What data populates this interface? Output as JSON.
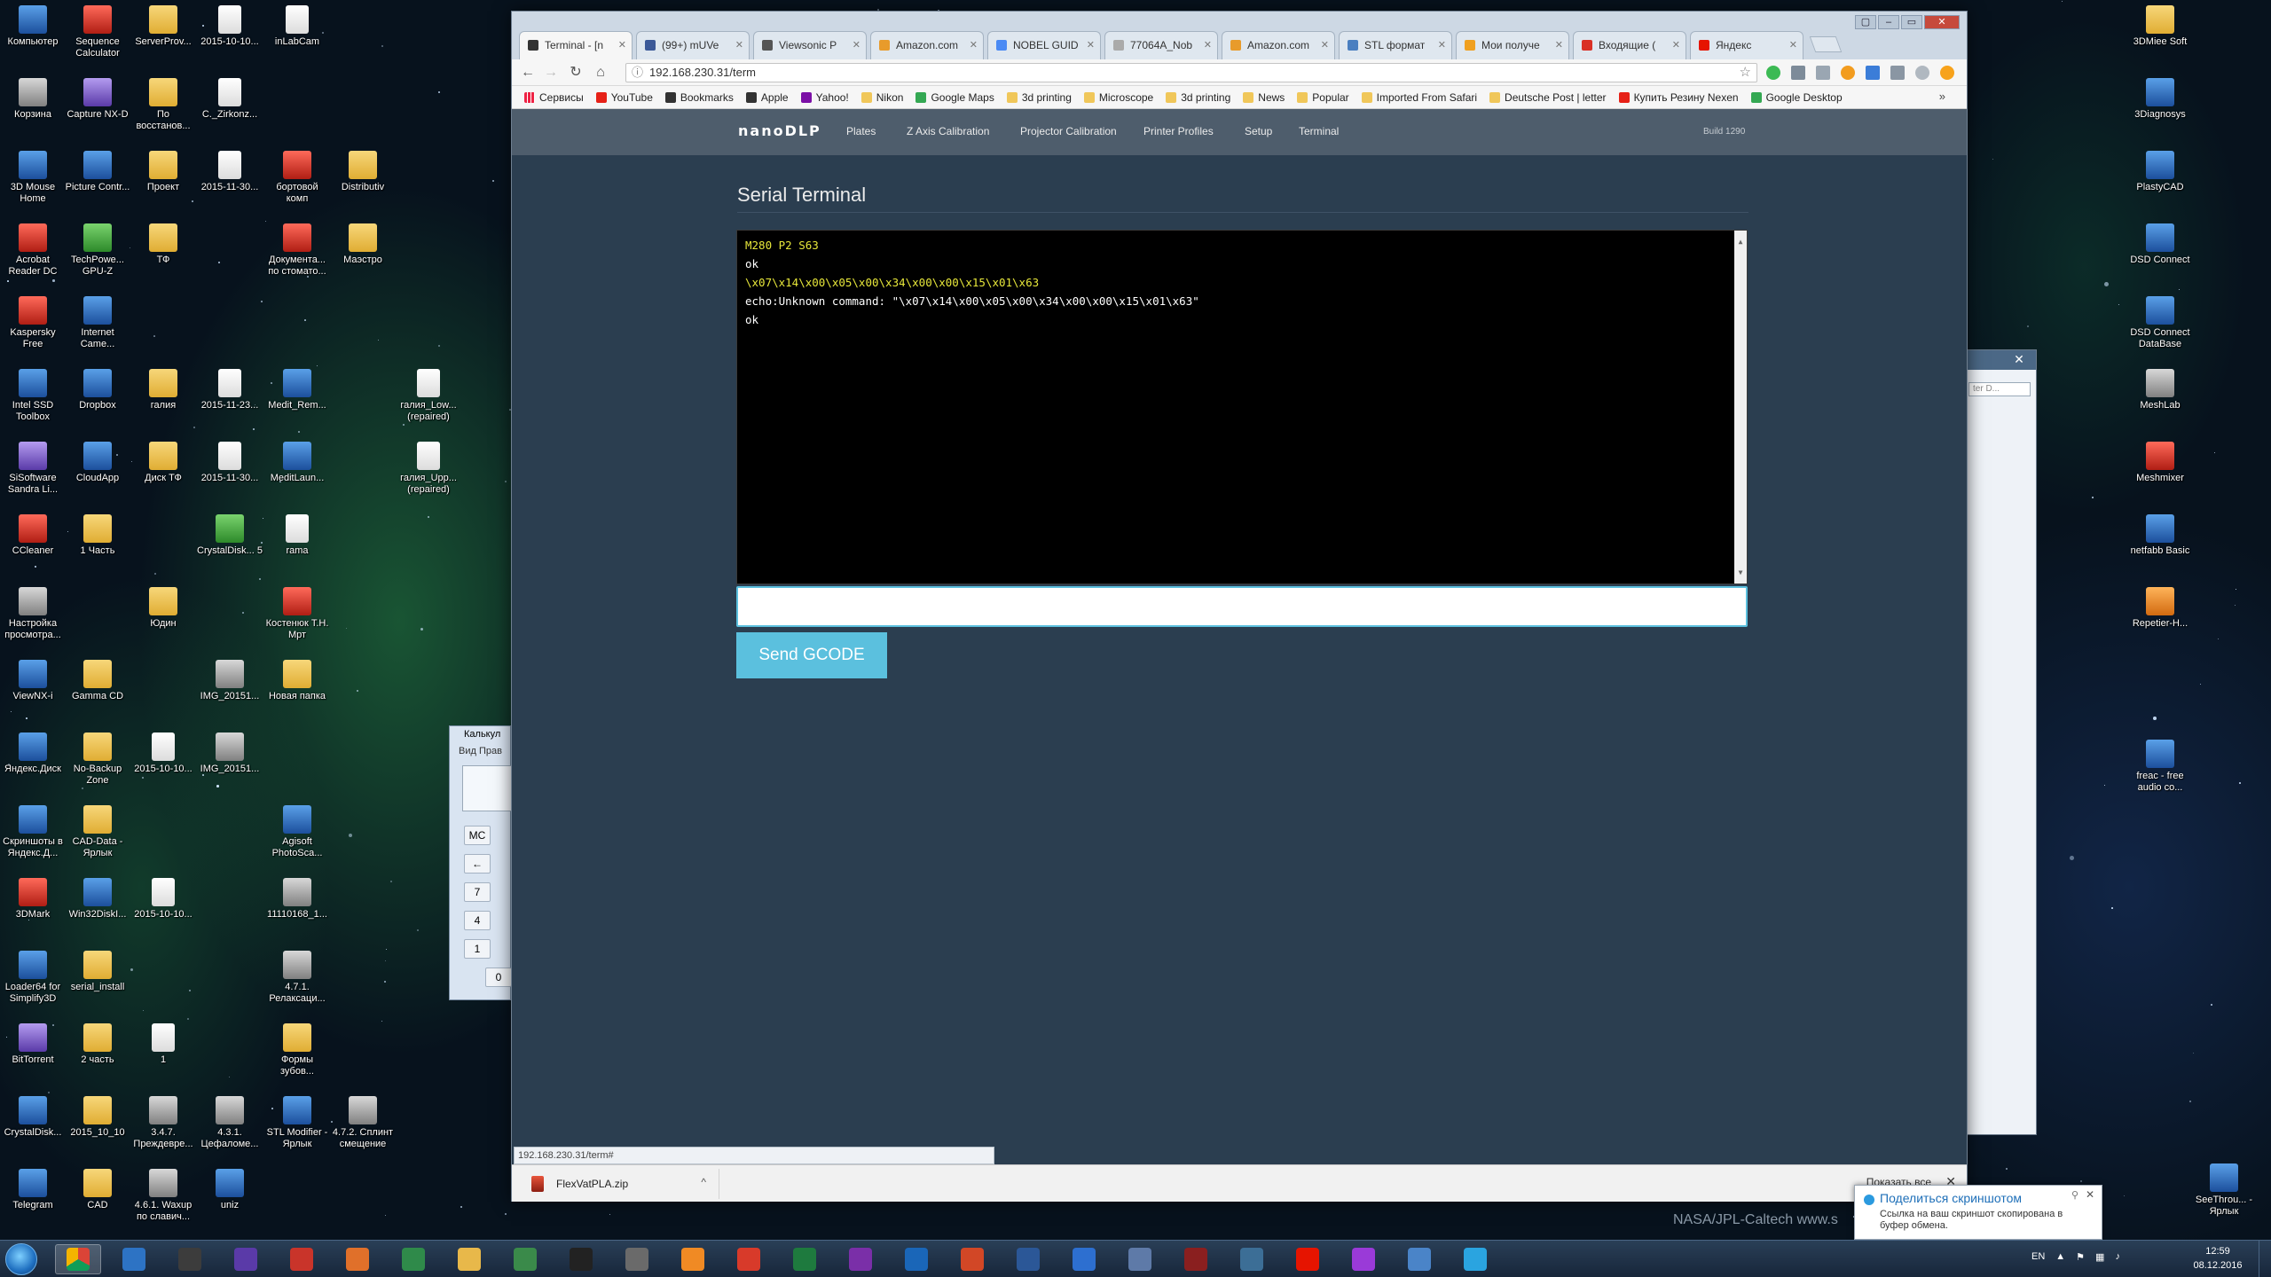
{
  "desktop": {
    "icons_left": [
      {
        "label": "Компьютер",
        "kind": "app"
      },
      {
        "label": "Sequence Calculator",
        "kind": "red"
      },
      {
        "label": "ServerProv...",
        "kind": "folder"
      },
      {
        "label": "2015-10-10...",
        "kind": "file"
      },
      {
        "label": "inLabCam",
        "kind": "file"
      },
      {
        "label": "Корзина",
        "kind": "gray"
      },
      {
        "label": "Capture NX-D",
        "kind": "purple"
      },
      {
        "label": "По восстанов...",
        "kind": "folder"
      },
      {
        "label": "C._Zirkonz...",
        "kind": "file"
      },
      {
        "label": "3D Mouse Home",
        "kind": "app"
      },
      {
        "label": "Picture Contr...",
        "kind": "app"
      },
      {
        "label": "Проект",
        "kind": "folder"
      },
      {
        "label": "2015-11-30...",
        "kind": "file"
      },
      {
        "label": "бортовой комп",
        "kind": "red"
      },
      {
        "label": "Distributiv",
        "kind": "folder"
      },
      {
        "label": "Acrobat Reader DC",
        "kind": "red"
      },
      {
        "label": "TechPowe... GPU-Z",
        "kind": "green"
      },
      {
        "label": "ТФ",
        "kind": "folder"
      },
      {
        "label": "Документа... по стомато...",
        "kind": "red"
      },
      {
        "label": "Маэстро",
        "kind": "folder"
      },
      {
        "label": "Kaspersky Free",
        "kind": "red"
      },
      {
        "label": "Internet Came...",
        "kind": "app"
      },
      {
        "label": "Intel SSD Toolbox",
        "kind": "app"
      },
      {
        "label": "Dropbox",
        "kind": "app"
      },
      {
        "label": "галия",
        "kind": "folder"
      },
      {
        "label": "2015-11-23...",
        "kind": "file"
      },
      {
        "label": "Medit_Rem...",
        "kind": "app"
      },
      {
        "label": "галия_Low... (repaired)",
        "kind": "file"
      },
      {
        "label": "SiSoftware Sandra Li...",
        "kind": "purple"
      },
      {
        "label": "CloudApp",
        "kind": "app"
      },
      {
        "label": "Диск ТФ",
        "kind": "folder"
      },
      {
        "label": "2015-11-30...",
        "kind": "file"
      },
      {
        "label": "MeditLaun...",
        "kind": "app"
      },
      {
        "label": "галия_Upp... (repaired)",
        "kind": "file"
      },
      {
        "label": "CCleaner",
        "kind": "red"
      },
      {
        "label": "1 Часть",
        "kind": "folder"
      },
      {
        "label": "CrystalDisk... 5",
        "kind": "green"
      },
      {
        "label": "rama",
        "kind": "file"
      },
      {
        "label": "Настройка просмотра...",
        "kind": "gray"
      },
      {
        "label": "Юдин",
        "kind": "folder"
      },
      {
        "label": "Костенюк Т.Н. Мрт",
        "kind": "red"
      },
      {
        "label": "ViewNX-i",
        "kind": "app"
      },
      {
        "label": "Gamma CD",
        "kind": "folder"
      },
      {
        "label": "IMG_20151...",
        "kind": "gray"
      },
      {
        "label": "Новая папка",
        "kind": "folder"
      },
      {
        "label": "Яндекс.Диск",
        "kind": "app"
      },
      {
        "label": "No-Backup Zone",
        "kind": "folder"
      },
      {
        "label": "2015-10-10...",
        "kind": "file"
      },
      {
        "label": "IMG_20151...",
        "kind": "gray"
      },
      {
        "label": "Скриншоты в Яндекс.Д...",
        "kind": "app"
      },
      {
        "label": "CAD-Data - Ярлык",
        "kind": "folder"
      },
      {
        "label": "Agisoft PhotoSca...",
        "kind": "app"
      },
      {
        "label": "3DMark",
        "kind": "red"
      },
      {
        "label": "Win32DiskI...",
        "kind": "app"
      },
      {
        "label": "2015-10-10...",
        "kind": "file"
      },
      {
        "label": "11110168_1...",
        "kind": "gray"
      },
      {
        "label": "Loader64 for Simplify3D",
        "kind": "app"
      },
      {
        "label": "serial_install",
        "kind": "folder"
      },
      {
        "label": "4.7.1. Релаксаци...",
        "kind": "gray"
      },
      {
        "label": "BitTorrent",
        "kind": "purple"
      },
      {
        "label": "2 часть",
        "kind": "folder"
      },
      {
        "label": "1",
        "kind": "file"
      },
      {
        "label": "Формы зубов...",
        "kind": "folder"
      },
      {
        "label": "CrystalDisk...",
        "kind": "app"
      },
      {
        "label": "2015_10_10",
        "kind": "folder"
      },
      {
        "label": "3.4.7. Преждевре...",
        "kind": "gray"
      },
      {
        "label": "4.3.1. Цефаломе...",
        "kind": "gray"
      },
      {
        "label": "STL Modifier - Ярлык",
        "kind": "app"
      },
      {
        "label": "4.7.2. Сплинт смещение",
        "kind": "gray"
      },
      {
        "label": "Telegram",
        "kind": "app"
      },
      {
        "label": "CAD",
        "kind": "folder"
      },
      {
        "label": "4.6.1. Waxup по славич...",
        "kind": "gray"
      },
      {
        "label": "uniz",
        "kind": "app"
      }
    ],
    "icons_right": [
      {
        "label": "3DMiee Soft",
        "kind": "folder"
      },
      {
        "label": "3Diagnosys",
        "kind": "app"
      },
      {
        "label": "PlastyCAD",
        "kind": "app"
      },
      {
        "label": "DSD Connect",
        "kind": "app"
      },
      {
        "label": "DSD Connect DataBase",
        "kind": "app"
      },
      {
        "label": "MeshLab",
        "kind": "gray"
      },
      {
        "label": "Meshmixer",
        "kind": "red"
      },
      {
        "label": "netfabb Basic",
        "kind": "app"
      },
      {
        "label": "Repetier-H...",
        "kind": "orange"
      },
      {
        "label": "freac - free audio co...",
        "kind": "app"
      },
      {
        "label": "SeeThrou... - Ярлык",
        "kind": "app"
      }
    ],
    "credit": "NASA/JPL-Caltech   www.s"
  },
  "calculator": {
    "title": "Калькул",
    "menu": "Вид   Прав",
    "keys": [
      "MC",
      "←",
      "7",
      "4",
      "1",
      "0"
    ]
  },
  "bg_window": {
    "close": "✕",
    "search_placeholder": "ter D..."
  },
  "browser": {
    "window_controls": [
      "▢",
      "–",
      "▭",
      "✕"
    ],
    "tabs": [
      {
        "label": "Terminal - [n",
        "active": true,
        "color": "#333333"
      },
      {
        "label": "(99+) mUVe",
        "active": false,
        "color": "#3b5998"
      },
      {
        "label": "Viewsonic P",
        "active": false,
        "color": "#555555"
      },
      {
        "label": "Amazon.com",
        "active": false,
        "color": "#e89b2b"
      },
      {
        "label": "NOBEL GUID",
        "active": false,
        "color": "#4a8af4"
      },
      {
        "label": "77064A_Nob",
        "active": false,
        "color": "#aaaaaa"
      },
      {
        "label": "Amazon.com",
        "active": false,
        "color": "#e89b2b"
      },
      {
        "label": "STL формат",
        "active": false,
        "color": "#4a7fc0"
      },
      {
        "label": "Мои получе",
        "active": false,
        "color": "#f0a020"
      },
      {
        "label": "Входящие (",
        "active": false,
        "color": "#d93025"
      },
      {
        "label": "Яндекс",
        "active": false,
        "color": "#e61400"
      }
    ],
    "url": "192.168.230.31/term",
    "bookmarks": [
      {
        "label": "Сервисы",
        "kind": "grid"
      },
      {
        "label": "YouTube",
        "kind": "yt"
      },
      {
        "label": "Bookmarks",
        "kind": "dark"
      },
      {
        "label": "Apple",
        "kind": "dark"
      },
      {
        "label": "Yahoo!",
        "kind": "y"
      },
      {
        "label": "Nikon",
        "kind": "folder"
      },
      {
        "label": "Google Maps",
        "kind": "gm"
      },
      {
        "label": "3d printing",
        "kind": "folder"
      },
      {
        "label": "Microscope",
        "kind": "folder"
      },
      {
        "label": "3d printing",
        "kind": "folder"
      },
      {
        "label": "News",
        "kind": "folder"
      },
      {
        "label": "Popular",
        "kind": "folder"
      },
      {
        "label": "Imported From Safari",
        "kind": "folder"
      },
      {
        "label": "Deutsche Post | letter",
        "kind": "folder"
      },
      {
        "label": "Купить Резину Nexen",
        "kind": "yt"
      },
      {
        "label": "Google Desktop",
        "kind": "gm"
      }
    ],
    "bookmarks_more": "»",
    "status_url": "192.168.230.31/term#",
    "download": {
      "file": "FlexVatPLA.zip",
      "show_all": "Показать все",
      "close": "✕"
    }
  },
  "app": {
    "brand": "nanoDLP",
    "nav": [
      "Plates",
      "Z Axis Calibration",
      "Projector Calibration",
      "Printer Profiles",
      "Setup",
      "Terminal"
    ],
    "build": "Build 1290",
    "title": "Serial Terminal",
    "terminal_lines": [
      {
        "text": "M280 P2 S63",
        "type": "cmd"
      },
      {
        "text": "ok",
        "type": "resp"
      },
      {
        "text": "\\x07\\x14\\x00\\x05\\x00\\x34\\x00\\x00\\x15\\x01\\x63",
        "type": "cmd"
      },
      {
        "text": "echo:Unknown command: \"\\x07\\x14\\x00\\x05\\x00\\x34\\x00\\x00\\x15\\x01\\x63\"",
        "type": "resp"
      },
      {
        "text": "ok",
        "type": "resp"
      }
    ],
    "command_value": "",
    "send_label": "Send GCODE",
    "accent": "#5bc0de",
    "navbar_color": "#4e5d6c",
    "bg_color": "#2b3e50"
  },
  "notification": {
    "title": "Поделиться скриншотом",
    "text": "Ссылка на ваш скриншот скопирована в буфер обмена."
  },
  "taskbar": {
    "apps": [
      "Chrome",
      "Outlook",
      "Steam",
      "Cinema4D",
      "Repetier",
      "Chrome Dev",
      "Monitor",
      "Explorer",
      "Notepad",
      "exo",
      "Files",
      "Firefox",
      "Weibo",
      "Excel",
      "OneNote",
      "Outlook Mail",
      "PowerPoint",
      "Word",
      "Visual Studio",
      "Settings",
      "Draw",
      "Cloud",
      "Yandex",
      "CCleaner",
      "Calc",
      "Telegram"
    ],
    "lang": "EN",
    "time": "12:59",
    "date": "08.12.2016"
  }
}
